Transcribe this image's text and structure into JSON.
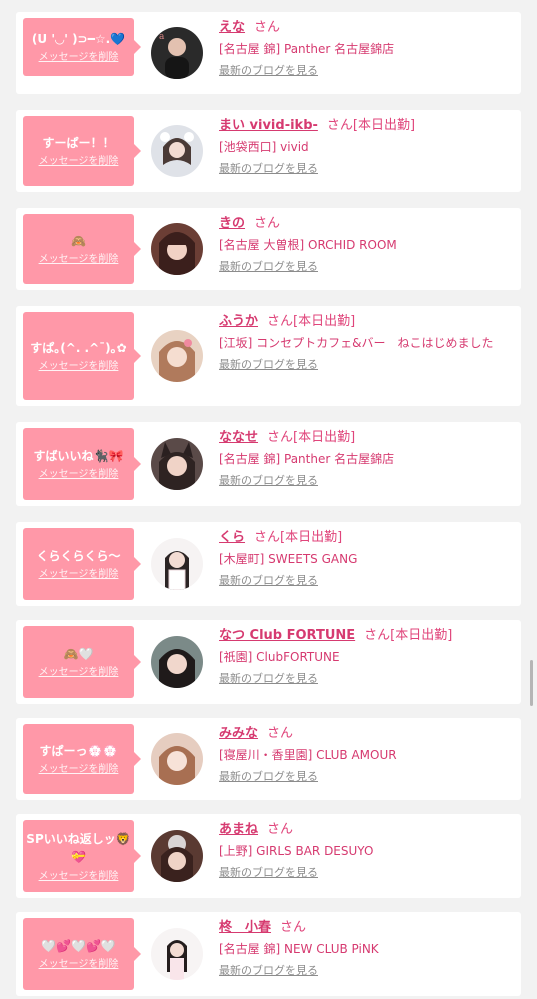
{
  "page": {
    "delete_label": "メッセージを削除",
    "blog_label": "最新のブログを見る",
    "san_label": "さん"
  },
  "items": [
    {
      "message": "(U '◡' )⊃━☆.💙",
      "name": "えな",
      "status": "",
      "shop": "[名古屋 錦] Panther 名古屋錦店",
      "avatar_color": "#2a2a2a"
    },
    {
      "message": "すーぱー！！",
      "name": "まい vivid-ikb-",
      "status": "[本日出勤]",
      "shop": "[池袋西口] vivid",
      "avatar_color": "#cfd4dc"
    },
    {
      "message": "🙈",
      "name": "きの",
      "status": "",
      "shop": "[名古屋 大曽根] ORCHID ROOM",
      "avatar_color": "#7a4b3e"
    },
    {
      "message": "すぱ｡(^. .^ˉ)｡✿",
      "name": "ふうか",
      "status": "[本日出勤]",
      "shop": "[江坂] コンセプトカフェ&バー　ねこはじめました",
      "avatar_color": "#c9967a"
    },
    {
      "message": "すばいいね🐈‍⬛🎀",
      "name": "ななせ",
      "status": "[本日出勤]",
      "shop": "[名古屋 錦] Panther 名古屋錦店",
      "avatar_color": "#4b3b3a"
    },
    {
      "message": "くらくらくら〜",
      "name": "くら",
      "status": "[本日出勤]",
      "shop": "[木屋町] SWEETS GANG",
      "avatar_color": "#eeeaea"
    },
    {
      "message": "🙈🤍",
      "name": "なつ Club FORTUNE",
      "status": "[本日出勤]",
      "shop": "[祇園] ClubFORTUNE",
      "avatar_color": "#5b6b6a"
    },
    {
      "message": "すぱーっ💮💮",
      "name": "みみな",
      "status": "",
      "shop": "[寝屋川・香里園] CLUB AMOUR",
      "avatar_color": "#d9b3a1"
    },
    {
      "message": "SPいいね返しッ🦁💝",
      "name": "あまね",
      "status": "",
      "shop": "[上野] GIRLS BAR DESUYO",
      "avatar_color": "#4a2e29"
    },
    {
      "message": "🤍💕🤍💕🤍",
      "name": "柊　小春",
      "status": "",
      "shop": "[名古屋 錦] NEW CLUB PiNK",
      "avatar_color": "#f4f1f1"
    }
  ]
}
